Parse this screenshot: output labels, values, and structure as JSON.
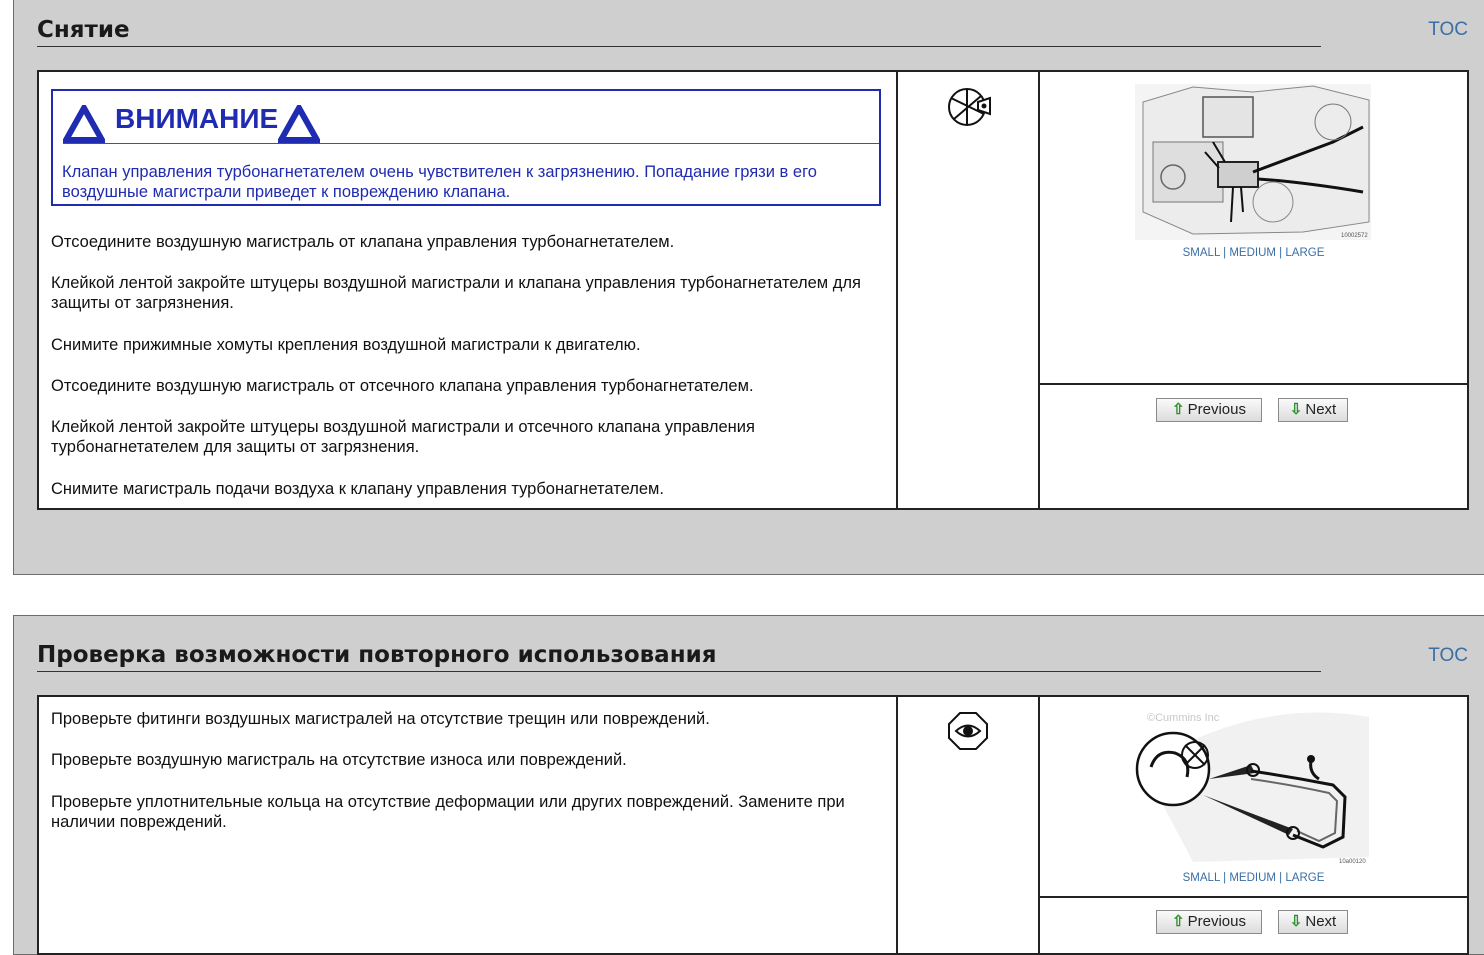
{
  "section1": {
    "title": "Снятие",
    "toc": "TOC",
    "caution": {
      "label": "ВНИМАНИЕ",
      "text": "Клапан управления турбонагнетателем очень чувствителен к загрязнению. Попадание грязи в его воздушные магистрали приведет к повреждению клапана."
    },
    "steps": [
      "Отсоедините воздушную магистраль от клапана управления турбонагнетателем.",
      "Клейкой лентой закройте штуцеры воздушной магистрали и клапана управления турбонагнетателем для защиты от загрязнения.",
      "Снимите прижимные хомуты крепления воздушной магистрали к двигателю.",
      "Отсоедините воздушную магистраль от отсечного клапана управления турбонагнетателем.",
      "Клейкой лентой закройте штуцеры воздушной магистрали и отсечного клапана управления турбонагнетателем для защиты от загрязнения.",
      "Снимите магистраль подачи воздуха к клапану управления турбонагнетателем."
    ],
    "image_sizes": {
      "small": "SMALL",
      "medium": "MEDIUM",
      "large": "LARGE",
      "sep": "|"
    },
    "image_id": "10002572",
    "prev": "Previous",
    "next": "Next"
  },
  "section2": {
    "title": "Проверка возможности повторного использования",
    "toc": "TOC",
    "steps": [
      "Проверьте фитинги воздушных магистралей на отсутствие трещин или повреждений.",
      "Проверьте воздушную магистраль на отсутствие износа или повреждений.",
      "Проверьте уплотнительные кольца на отсутствие деформации или других повреждений. Замените при наличии повреждений."
    ],
    "image_sizes": {
      "small": "SMALL",
      "medium": "MEDIUM",
      "large": "LARGE",
      "sep": "|"
    },
    "image_watermark": "©Cummins Inc",
    "image_id": "10a00120",
    "prev": "Previous",
    "next": "Next"
  }
}
